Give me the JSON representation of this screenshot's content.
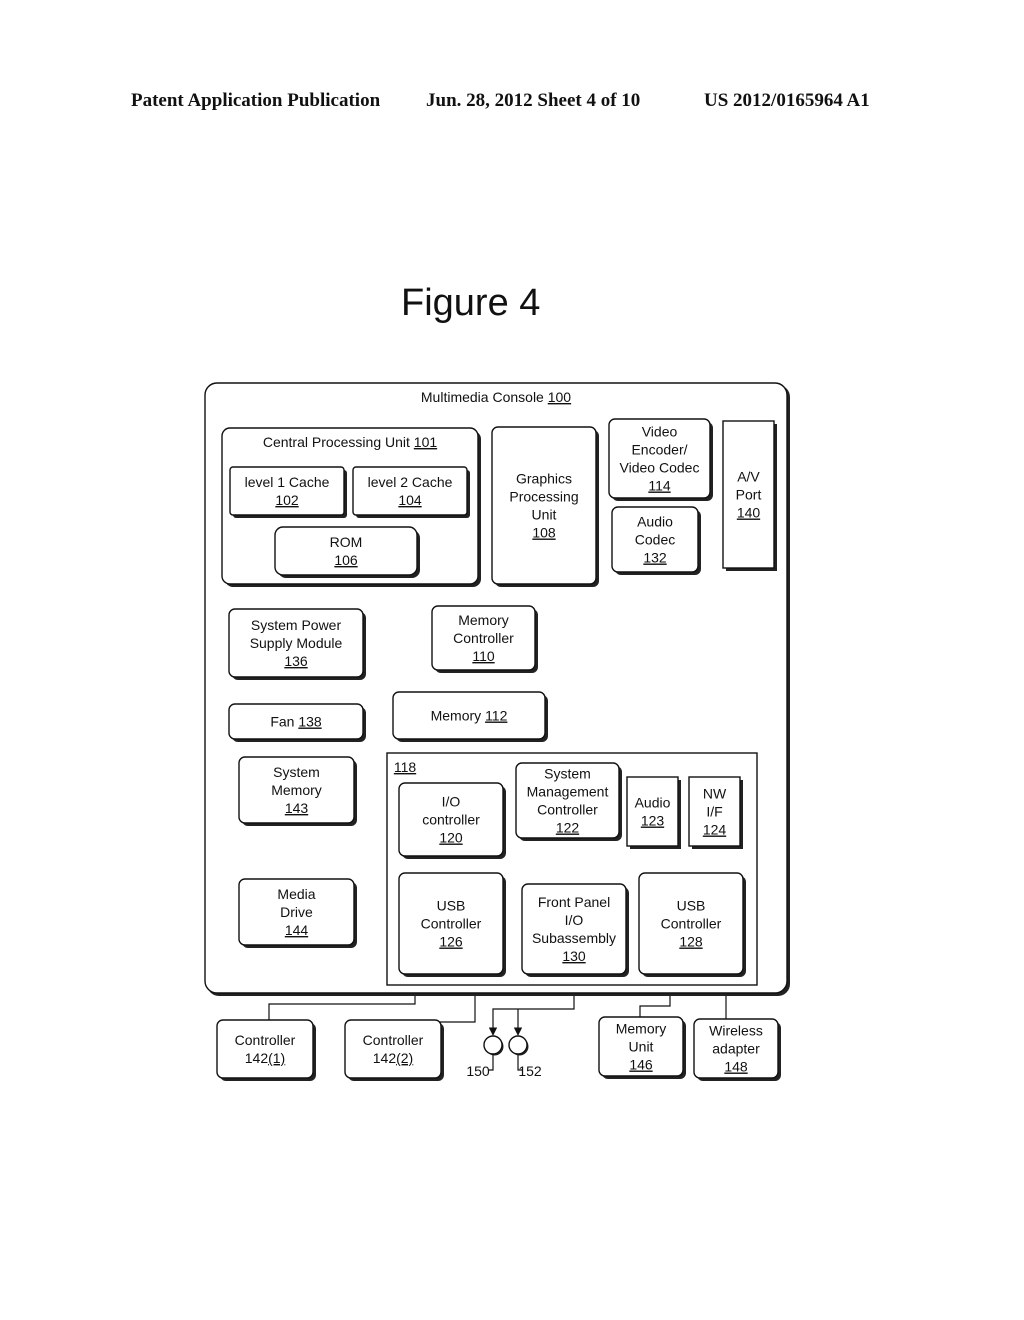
{
  "header": {
    "publication": "Patent Application Publication",
    "date_sheet": "Jun. 28, 2012  Sheet 4 of 10",
    "number": "US 2012/0165964 A1"
  },
  "figure": {
    "title": "Figure 4"
  },
  "diagram": {
    "console": {
      "label": "Multimedia Console",
      "ref": "100"
    },
    "bridge": {
      "ref": "118"
    },
    "blocks": [
      {
        "id": "cpu",
        "lines": [
          "Central Processing Unit"
        ],
        "ref": "101",
        "inline_ref": true
      },
      {
        "id": "l1",
        "lines": [
          "level 1 Cache"
        ],
        "ref": "102"
      },
      {
        "id": "l2",
        "lines": [
          "level 2 Cache"
        ],
        "ref": "104"
      },
      {
        "id": "rom",
        "lines": [
          "ROM"
        ],
        "ref": "106"
      },
      {
        "id": "gpu",
        "lines": [
          "Graphics",
          "Processing",
          "Unit"
        ],
        "ref": "108"
      },
      {
        "id": "venc",
        "lines": [
          "Video",
          "Encoder/",
          "Video Codec"
        ],
        "ref": "114"
      },
      {
        "id": "av",
        "lines": [
          "A/V",
          "Port"
        ],
        "ref": "140"
      },
      {
        "id": "acodec",
        "lines": [
          "Audio",
          "Codec"
        ],
        "ref": "132"
      },
      {
        "id": "psu",
        "lines": [
          "System Power",
          "Supply Module"
        ],
        "ref": "136"
      },
      {
        "id": "memctl",
        "lines": [
          "Memory",
          "Controller"
        ],
        "ref": "110"
      },
      {
        "id": "fan",
        "lines": [
          "Fan"
        ],
        "ref": "138",
        "inline_ref": true
      },
      {
        "id": "mem",
        "lines": [
          "Memory"
        ],
        "ref": "112",
        "inline_ref": true
      },
      {
        "id": "sysmem",
        "lines": [
          "System",
          "Memory"
        ],
        "ref": "143"
      },
      {
        "id": "mdrive",
        "lines": [
          "Media",
          "Drive"
        ],
        "ref": "144"
      },
      {
        "id": "ioctl",
        "lines": [
          "I/O",
          "controller"
        ],
        "ref": "120"
      },
      {
        "id": "smc",
        "lines": [
          "System",
          "Management",
          "Controller"
        ],
        "ref": "122"
      },
      {
        "id": "audio",
        "lines": [
          "Audio"
        ],
        "ref": "123"
      },
      {
        "id": "nwif",
        "lines": [
          "NW",
          "I/F"
        ],
        "ref": "124"
      },
      {
        "id": "usb1",
        "lines": [
          "USB",
          "Controller"
        ],
        "ref": "126"
      },
      {
        "id": "fpio",
        "lines": [
          "Front Panel",
          "I/O",
          "Subassembly"
        ],
        "ref": "130"
      },
      {
        "id": "usb2",
        "lines": [
          "USB",
          "Controller"
        ],
        "ref": "128"
      },
      {
        "id": "ctl1",
        "lines": [
          "Controller"
        ],
        "ref": "142(1)",
        "ref_prefix": "142",
        "ref_sub": "(1)"
      },
      {
        "id": "ctl2",
        "lines": [
          "Controller"
        ],
        "ref": "142(2)",
        "ref_prefix": "142",
        "ref_sub": "(2)"
      },
      {
        "id": "memunit",
        "lines": [
          "Memory",
          "Unit"
        ],
        "ref": "146"
      },
      {
        "id": "wireless",
        "lines": [
          "Wireless",
          "adapter"
        ],
        "ref": "148"
      }
    ],
    "indicators": [
      {
        "id": "led1",
        "ref": "150"
      },
      {
        "id": "led2",
        "ref": "152"
      }
    ]
  }
}
